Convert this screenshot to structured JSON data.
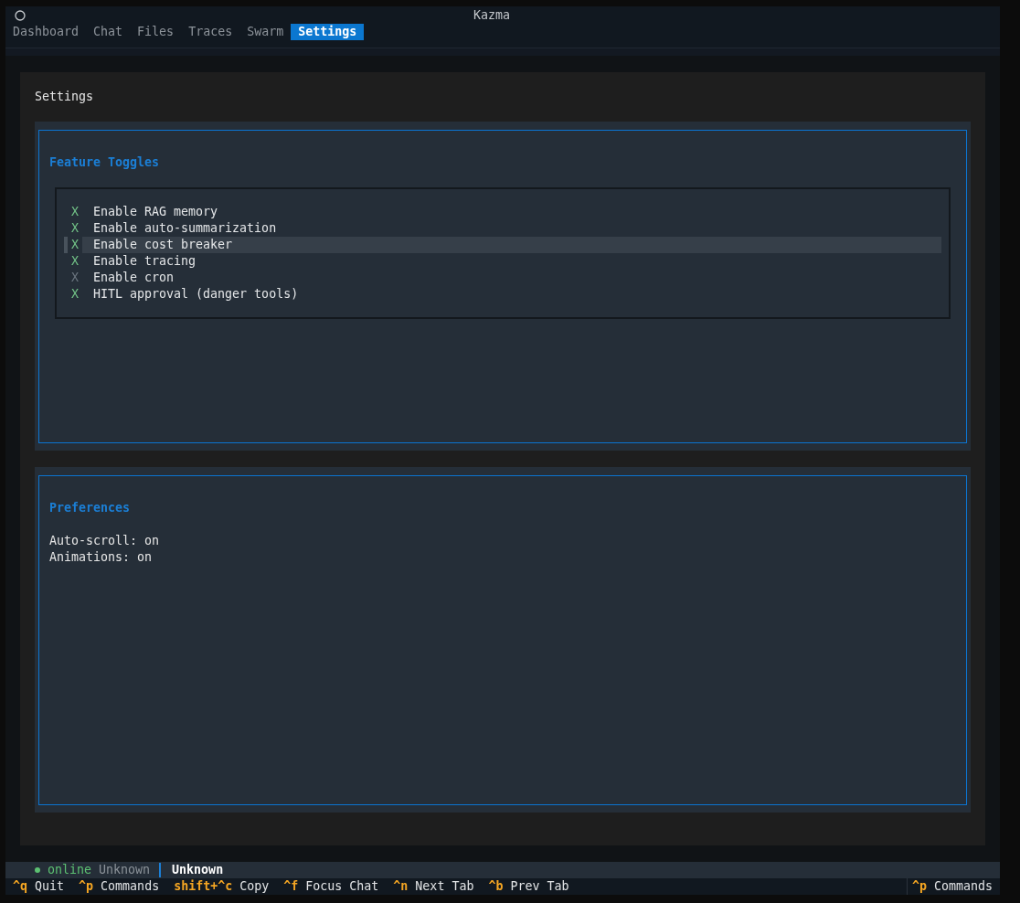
{
  "header": {
    "title": "Kazma"
  },
  "tabs": [
    {
      "label": "Dashboard",
      "selected": false
    },
    {
      "label": "Chat",
      "selected": false
    },
    {
      "label": "Files",
      "selected": false
    },
    {
      "label": "Traces",
      "selected": false
    },
    {
      "label": "Swarm",
      "selected": false
    },
    {
      "label": "Settings",
      "selected": true
    }
  ],
  "panel": {
    "title": "Settings"
  },
  "feature_toggles": {
    "title": "Feature Toggles",
    "items": [
      {
        "mark": "X",
        "label": "Enable RAG memory",
        "checked": true,
        "selected": false
      },
      {
        "mark": "X",
        "label": "Enable auto-summarization",
        "checked": true,
        "selected": false
      },
      {
        "mark": "X",
        "label": "Enable cost breaker",
        "checked": true,
        "selected": true
      },
      {
        "mark": "X",
        "label": "Enable tracing",
        "checked": true,
        "selected": false
      },
      {
        "mark": "X",
        "label": "Enable cron",
        "checked": false,
        "selected": false
      },
      {
        "mark": "X",
        "label": "HITL approval (danger tools)",
        "checked": true,
        "selected": false
      }
    ]
  },
  "preferences": {
    "title": "Preferences",
    "lines": [
      "Auto-scroll: on",
      "Animations: on"
    ]
  },
  "status_bar": {
    "online": true,
    "connection": "online",
    "model": "Unknown",
    "profile": "Unknown"
  },
  "footer": {
    "bindings": [
      {
        "key": "^q",
        "action": "Quit"
      },
      {
        "key": "^p",
        "action": "Commands"
      },
      {
        "key": "shift+^c",
        "action": "Copy"
      },
      {
        "key": "^f",
        "action": "Focus Chat"
      },
      {
        "key": "^n",
        "action": "Next Tab"
      },
      {
        "key": "^b",
        "action": "Prev Tab"
      }
    ],
    "right_binding": {
      "key": "^p",
      "action": "Commands"
    }
  }
}
